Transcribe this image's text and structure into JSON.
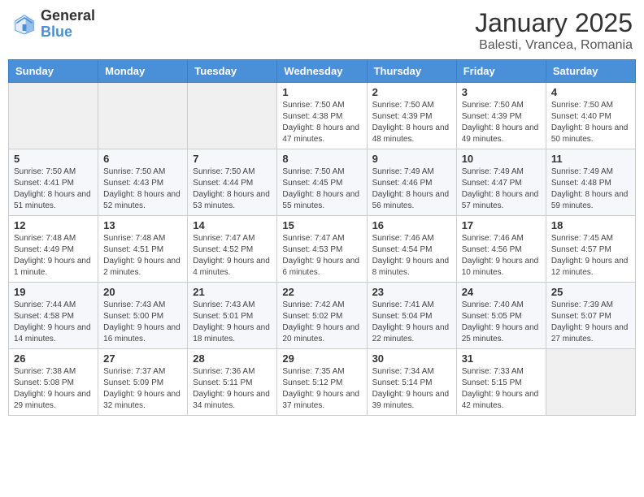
{
  "logo": {
    "general": "General",
    "blue": "Blue"
  },
  "header": {
    "title": "January 2025",
    "subtitle": "Balesti, Vrancea, Romania"
  },
  "weekdays": [
    "Sunday",
    "Monday",
    "Tuesday",
    "Wednesday",
    "Thursday",
    "Friday",
    "Saturday"
  ],
  "weeks": [
    [
      {
        "day": "",
        "info": ""
      },
      {
        "day": "",
        "info": ""
      },
      {
        "day": "",
        "info": ""
      },
      {
        "day": "1",
        "info": "Sunrise: 7:50 AM\nSunset: 4:38 PM\nDaylight: 8 hours and 47 minutes."
      },
      {
        "day": "2",
        "info": "Sunrise: 7:50 AM\nSunset: 4:39 PM\nDaylight: 8 hours and 48 minutes."
      },
      {
        "day": "3",
        "info": "Sunrise: 7:50 AM\nSunset: 4:39 PM\nDaylight: 8 hours and 49 minutes."
      },
      {
        "day": "4",
        "info": "Sunrise: 7:50 AM\nSunset: 4:40 PM\nDaylight: 8 hours and 50 minutes."
      }
    ],
    [
      {
        "day": "5",
        "info": "Sunrise: 7:50 AM\nSunset: 4:41 PM\nDaylight: 8 hours and 51 minutes."
      },
      {
        "day": "6",
        "info": "Sunrise: 7:50 AM\nSunset: 4:43 PM\nDaylight: 8 hours and 52 minutes."
      },
      {
        "day": "7",
        "info": "Sunrise: 7:50 AM\nSunset: 4:44 PM\nDaylight: 8 hours and 53 minutes."
      },
      {
        "day": "8",
        "info": "Sunrise: 7:50 AM\nSunset: 4:45 PM\nDaylight: 8 hours and 55 minutes."
      },
      {
        "day": "9",
        "info": "Sunrise: 7:49 AM\nSunset: 4:46 PM\nDaylight: 8 hours and 56 minutes."
      },
      {
        "day": "10",
        "info": "Sunrise: 7:49 AM\nSunset: 4:47 PM\nDaylight: 8 hours and 57 minutes."
      },
      {
        "day": "11",
        "info": "Sunrise: 7:49 AM\nSunset: 4:48 PM\nDaylight: 8 hours and 59 minutes."
      }
    ],
    [
      {
        "day": "12",
        "info": "Sunrise: 7:48 AM\nSunset: 4:49 PM\nDaylight: 9 hours and 1 minute."
      },
      {
        "day": "13",
        "info": "Sunrise: 7:48 AM\nSunset: 4:51 PM\nDaylight: 9 hours and 2 minutes."
      },
      {
        "day": "14",
        "info": "Sunrise: 7:47 AM\nSunset: 4:52 PM\nDaylight: 9 hours and 4 minutes."
      },
      {
        "day": "15",
        "info": "Sunrise: 7:47 AM\nSunset: 4:53 PM\nDaylight: 9 hours and 6 minutes."
      },
      {
        "day": "16",
        "info": "Sunrise: 7:46 AM\nSunset: 4:54 PM\nDaylight: 9 hours and 8 minutes."
      },
      {
        "day": "17",
        "info": "Sunrise: 7:46 AM\nSunset: 4:56 PM\nDaylight: 9 hours and 10 minutes."
      },
      {
        "day": "18",
        "info": "Sunrise: 7:45 AM\nSunset: 4:57 PM\nDaylight: 9 hours and 12 minutes."
      }
    ],
    [
      {
        "day": "19",
        "info": "Sunrise: 7:44 AM\nSunset: 4:58 PM\nDaylight: 9 hours and 14 minutes."
      },
      {
        "day": "20",
        "info": "Sunrise: 7:43 AM\nSunset: 5:00 PM\nDaylight: 9 hours and 16 minutes."
      },
      {
        "day": "21",
        "info": "Sunrise: 7:43 AM\nSunset: 5:01 PM\nDaylight: 9 hours and 18 minutes."
      },
      {
        "day": "22",
        "info": "Sunrise: 7:42 AM\nSunset: 5:02 PM\nDaylight: 9 hours and 20 minutes."
      },
      {
        "day": "23",
        "info": "Sunrise: 7:41 AM\nSunset: 5:04 PM\nDaylight: 9 hours and 22 minutes."
      },
      {
        "day": "24",
        "info": "Sunrise: 7:40 AM\nSunset: 5:05 PM\nDaylight: 9 hours and 25 minutes."
      },
      {
        "day": "25",
        "info": "Sunrise: 7:39 AM\nSunset: 5:07 PM\nDaylight: 9 hours and 27 minutes."
      }
    ],
    [
      {
        "day": "26",
        "info": "Sunrise: 7:38 AM\nSunset: 5:08 PM\nDaylight: 9 hours and 29 minutes."
      },
      {
        "day": "27",
        "info": "Sunrise: 7:37 AM\nSunset: 5:09 PM\nDaylight: 9 hours and 32 minutes."
      },
      {
        "day": "28",
        "info": "Sunrise: 7:36 AM\nSunset: 5:11 PM\nDaylight: 9 hours and 34 minutes."
      },
      {
        "day": "29",
        "info": "Sunrise: 7:35 AM\nSunset: 5:12 PM\nDaylight: 9 hours and 37 minutes."
      },
      {
        "day": "30",
        "info": "Sunrise: 7:34 AM\nSunset: 5:14 PM\nDaylight: 9 hours and 39 minutes."
      },
      {
        "day": "31",
        "info": "Sunrise: 7:33 AM\nSunset: 5:15 PM\nDaylight: 9 hours and 42 minutes."
      },
      {
        "day": "",
        "info": ""
      }
    ]
  ]
}
